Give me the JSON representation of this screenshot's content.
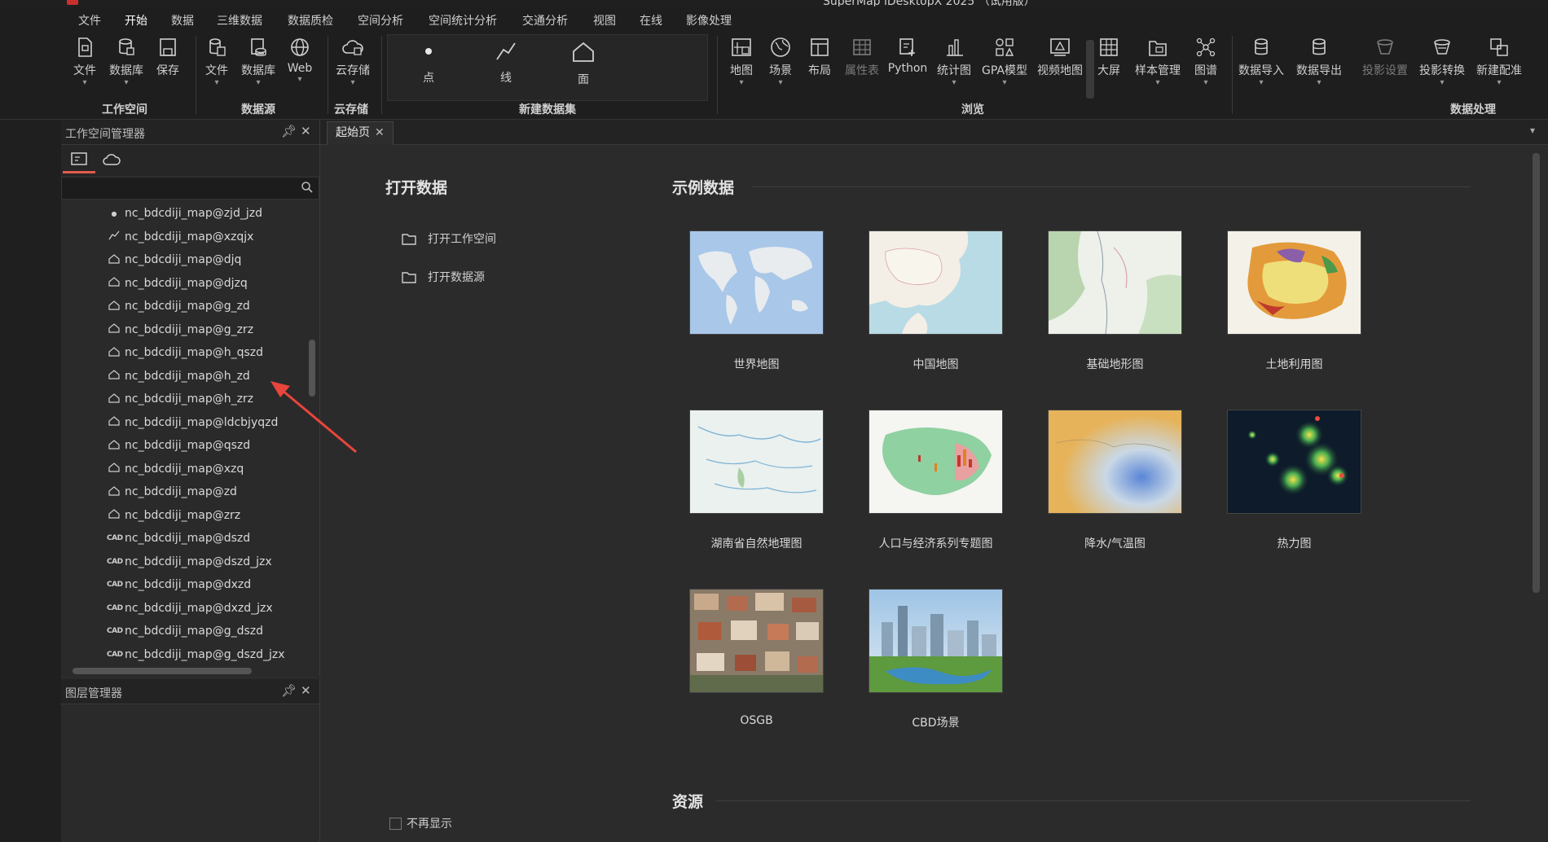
{
  "app": {
    "title": "SuperMap iDesktopX 2025 （试用版）"
  },
  "menu": [
    "文件",
    "开始",
    "数据",
    "三维数据",
    "数据质检",
    "空间分析",
    "空间统计分析",
    "交通分析",
    "视图",
    "在线",
    "影像处理"
  ],
  "menu_active": "开始",
  "ribbon": {
    "workspace": {
      "group": "工作空间",
      "buttons": [
        "文件",
        "数据库",
        "保存"
      ]
    },
    "datasource": {
      "group": "数据源",
      "buttons": [
        "文件",
        "数据库",
        "Web"
      ]
    },
    "cloud": {
      "group": "云存储",
      "buttons": [
        "云存储"
      ]
    },
    "new_dataset": {
      "group": "新建数据集",
      "buttons": [
        "点",
        "线",
        "面"
      ]
    },
    "browse": {
      "group": "浏览",
      "buttons": [
        "地图",
        "场景",
        "布局",
        "属性表",
        "Python",
        "统计图",
        "GPA模型",
        "视频地图",
        "大屏",
        "样本管理",
        "图谱"
      ]
    },
    "data_process": {
      "group": "数据处理",
      "buttons": [
        "数据导入",
        "数据导出",
        "投影设置",
        "投影转换",
        "新建配准"
      ]
    }
  },
  "workspace_manager": {
    "title": "工作空间管理器",
    "search": {
      "value": "",
      "placeholder": ""
    },
    "tree_items": [
      {
        "icon": "point",
        "label": "nc_bdcdiji_map@zjd_jzd"
      },
      {
        "icon": "line",
        "label": "nc_bdcdiji_map@xzqjx"
      },
      {
        "icon": "region",
        "label": "nc_bdcdiji_map@djq"
      },
      {
        "icon": "region",
        "label": "nc_bdcdiji_map@djzq"
      },
      {
        "icon": "region",
        "label": "nc_bdcdiji_map@g_zd"
      },
      {
        "icon": "region",
        "label": "nc_bdcdiji_map@g_zrz"
      },
      {
        "icon": "region",
        "label": "nc_bdcdiji_map@h_qszd"
      },
      {
        "icon": "region",
        "label": "nc_bdcdiji_map@h_zd"
      },
      {
        "icon": "region",
        "label": "nc_bdcdiji_map@h_zrz"
      },
      {
        "icon": "region",
        "label": "nc_bdcdiji_map@ldcbjyqzd"
      },
      {
        "icon": "region",
        "label": "nc_bdcdiji_map@qszd"
      },
      {
        "icon": "region",
        "label": "nc_bdcdiji_map@xzq"
      },
      {
        "icon": "region",
        "label": "nc_bdcdiji_map@zd"
      },
      {
        "icon": "region",
        "label": "nc_bdcdiji_map@zrz"
      },
      {
        "icon": "cad",
        "label": "nc_bdcdiji_map@dszd"
      },
      {
        "icon": "cad",
        "label": "nc_bdcdiji_map@dszd_jzx"
      },
      {
        "icon": "cad",
        "label": "nc_bdcdiji_map@dxzd"
      },
      {
        "icon": "cad",
        "label": "nc_bdcdiji_map@dxzd_jzx"
      },
      {
        "icon": "cad",
        "label": "nc_bdcdiji_map@g_dszd"
      },
      {
        "icon": "cad",
        "label": "nc_bdcdiji_map@g_dszd_jzx"
      }
    ],
    "cad_icon_text": "CAD"
  },
  "layer_manager": {
    "title": "图层管理器"
  },
  "doc_tab": {
    "label": "起始页"
  },
  "start_page": {
    "open_title": "打开数据",
    "open_items": [
      "打开工作空间",
      "打开数据源"
    ],
    "sample_title": "示例数据",
    "samples": [
      "世界地图",
      "中国地图",
      "基础地形图",
      "土地利用图",
      "湖南省自然地理图",
      "人口与经济系列专题图",
      "降水/气温图",
      "热力图",
      "OSGB",
      "CBD场景"
    ],
    "resources_title": "资源",
    "dont_show": "不再显示"
  },
  "colors": {
    "accent": "#e05a4f",
    "background": "#2b2b2b",
    "panel": "#2a2a2a",
    "arrow": "#e8453c"
  }
}
